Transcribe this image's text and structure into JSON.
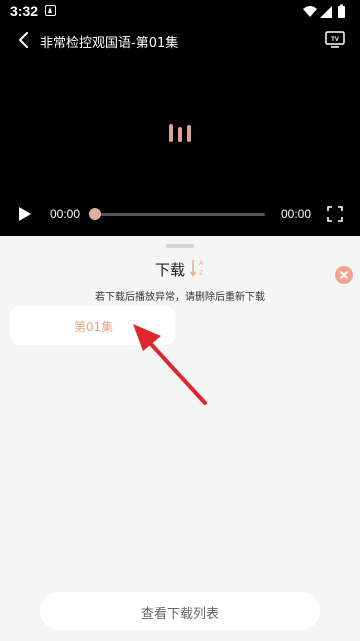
{
  "status_bar": {
    "time": "3:32"
  },
  "player": {
    "title": "非常检控观国语-第01集",
    "current_time": "00:00",
    "total_time": "00:00",
    "progress_fraction": 0.0
  },
  "sheet": {
    "title": "下载",
    "sort_glyph_top": "A",
    "sort_glyph_bottom": "Z",
    "hint": "若下载后播放异常，请删除后重新下载",
    "episodes": [
      {
        "label": "第01集"
      }
    ],
    "view_list_label": "查看下载列表"
  },
  "colors": {
    "accent": "#e9a38a",
    "close_button": "#f3a592",
    "annotation_arrow": "#e0262d"
  }
}
